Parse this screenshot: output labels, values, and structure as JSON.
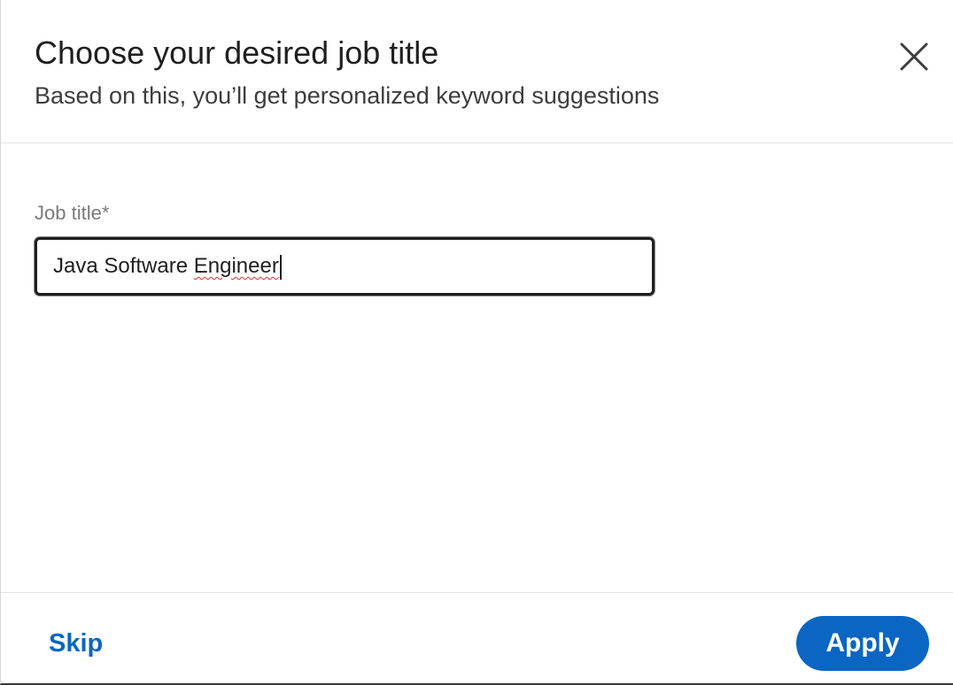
{
  "header": {
    "title": "Choose your desired job title",
    "subtitle": "Based on this, you’ll get personalized keyword suggestions",
    "close_icon": "close-icon"
  },
  "form": {
    "job_title_label": "Job title*",
    "job_title_value_part1": "Java Software ",
    "job_title_value_part2": "Engineer"
  },
  "footer": {
    "skip_label": "Skip",
    "apply_label": "Apply"
  },
  "colors": {
    "accent": "#0a66c2",
    "text_primary": "#1f1f1f",
    "text_label": "#7a7a7a",
    "spellcheck": "#d93025"
  }
}
